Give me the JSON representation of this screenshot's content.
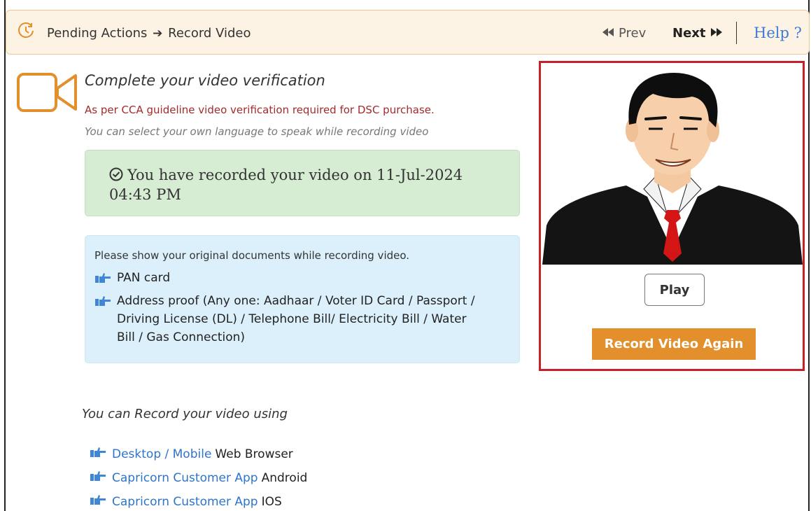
{
  "header": {
    "breadcrumb_start": "Pending Actions",
    "breadcrumb_end": "Record Video",
    "prev_label": "Prev",
    "next_label": "Next",
    "help_label": "Help ?"
  },
  "main": {
    "title": "Complete your video verification",
    "guideline": "As per CCA guideline video verification required for DSC purchase.",
    "language_note": "You can select your own language to speak while recording video",
    "recorded_message": "You have recorded your video on 11-Jul-2024 04:43 PM",
    "documents": {
      "intro": "Please show your original documents while recording video.",
      "items": [
        "PAN card",
        "Address proof (Any one: Aadhaar / Voter ID Card / Passport / Driving License (DL) / Telephone Bill/ Electricity Bill / Water Bill / Gas Connection)"
      ]
    }
  },
  "video_panel": {
    "play_label": "Play",
    "record_again_label": "Record Video Again"
  },
  "record_options": {
    "heading": "You can Record your video using",
    "items": [
      {
        "link": "Desktop / Mobile",
        "text": "Web Browser"
      },
      {
        "link": "Capricorn Customer App",
        "text": "Android"
      },
      {
        "link": "Capricorn Customer App",
        "text": "IOS"
      }
    ]
  },
  "colors": {
    "header_bg": "#fdf3e4",
    "accent_orange": "#e28f2c",
    "panel_border_red": "#c8202a",
    "success_bg": "#d6ecd3",
    "info_bg": "#dcf0fb",
    "link_blue": "#2e74c9"
  },
  "icons": [
    "clock-icon",
    "arrow-right-icon",
    "prev-icon",
    "next-icon",
    "video-camera-icon",
    "check-circle-icon",
    "hand-point-icon"
  ]
}
